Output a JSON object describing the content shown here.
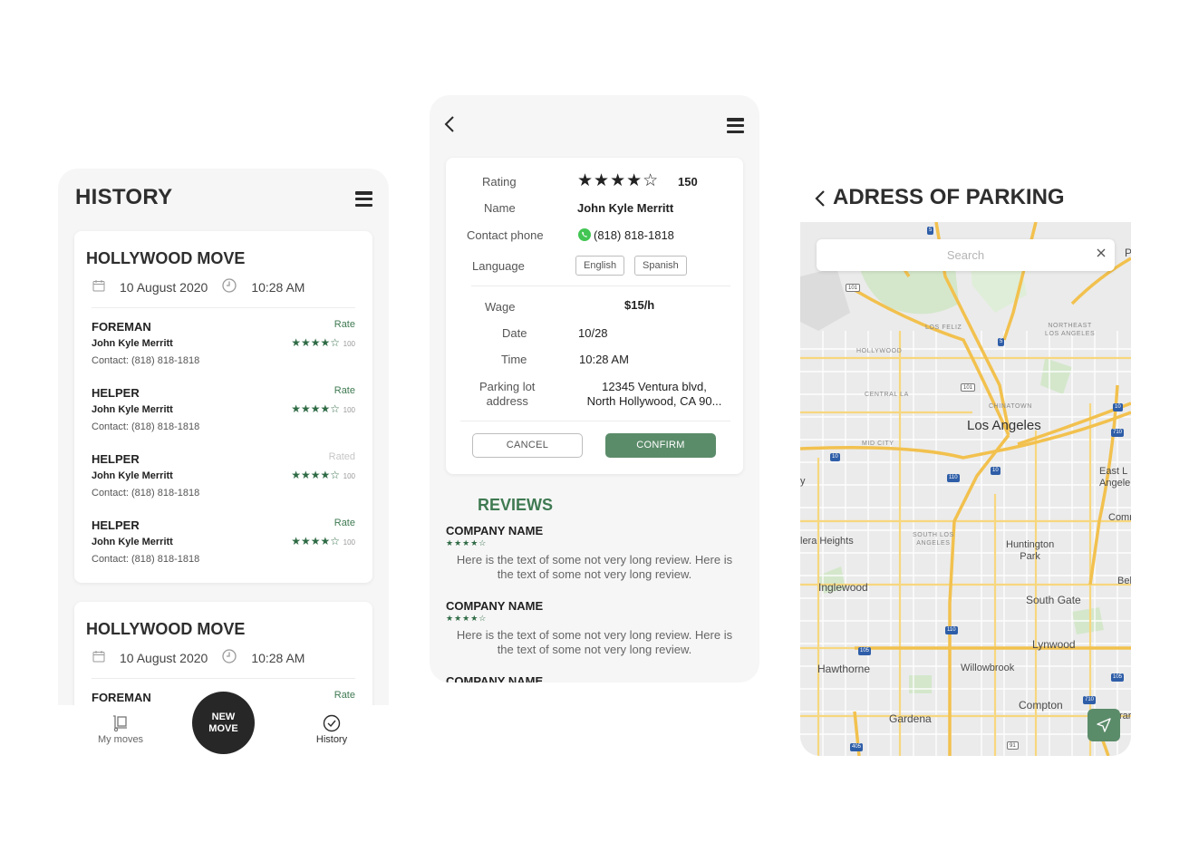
{
  "history": {
    "title": "HISTORY",
    "moves": [
      {
        "title": "HOLLYWOOD MOVE",
        "date": "10 August 2020",
        "time": "10:28 AM",
        "workers": [
          {
            "role": "FOREMAN",
            "name": "John Kyle Merritt",
            "contact": "Contact: (818) 818-1818",
            "action": "Rate",
            "stars": "★★★★☆",
            "count": "100"
          },
          {
            "role": "HELPER",
            "name": "John Kyle Merritt",
            "contact": "Contact: (818) 818-1818",
            "action": "Rate",
            "stars": "★★★★☆",
            "count": "100"
          },
          {
            "role": "HELPER",
            "name": "John Kyle Merritt",
            "contact": "Contact: (818) 818-1818",
            "action": "Rated",
            "stars": "★★★★☆",
            "count": "100"
          },
          {
            "role": "HELPER",
            "name": "John Kyle Merritt",
            "contact": "Contact: (818) 818-1818",
            "action": "Rate",
            "stars": "★★★★☆",
            "count": "100"
          }
        ]
      },
      {
        "title": "HOLLYWOOD MOVE",
        "date": "10 August 2020",
        "time": "10:28 AM",
        "workers": [
          {
            "role": "FOREMAN",
            "action": "Rate"
          }
        ]
      }
    ],
    "tabs": {
      "my_moves": "My moves",
      "new_move_line1": "NEW",
      "new_move_line2": "MOVE",
      "history": "History"
    }
  },
  "detail": {
    "labels": {
      "rating": "Rating",
      "name": "Name",
      "contact_phone": "Contact phone",
      "language": "Language",
      "wage": "Wage",
      "date": "Date",
      "time": "Time",
      "parking_line1": "Parking lot",
      "parking_line2": "address"
    },
    "values": {
      "stars": "★★★★☆",
      "rating_count": "150",
      "name": "John Kyle Merritt",
      "phone": "(818) 818-1818",
      "languages": [
        "English",
        "Spanish"
      ],
      "wage": "$15/h",
      "date": "10/28",
      "time": "10:28 AM",
      "address_line1": "12345 Ventura blvd,",
      "address_line2": "North Hollywood, CA 90..."
    },
    "buttons": {
      "cancel": "CANCEL",
      "confirm": "CONFIRM"
    },
    "reviews_title": "REVIEWS",
    "reviews": [
      {
        "company": "COMPANY NAME",
        "stars": "★★★★☆",
        "text_line1": "Here is the text of some not very long review. Here is",
        "text_line2": "the text of some not very long review."
      },
      {
        "company": "COMPANY NAME",
        "stars": "★★★★☆",
        "text_line1": "Here is the text of some not very long review. Here is",
        "text_line2": "the text of some not very long review."
      },
      {
        "company": "COMPANY NAME"
      }
    ]
  },
  "map_screen": {
    "title": "ADRESS OF PARKING",
    "search_placeholder": "Search",
    "labels": {
      "los_angeles": "Los Angeles",
      "los_feliz": "LOS FELIZ",
      "northeast_la_1": "NORTHEAST",
      "northeast_la_2": "LOS ANGELES",
      "hollywood": "HOLLYWOOD",
      "central_la": "CENTRAL LA",
      "chinatown": "CHINATOWN",
      "mid_city": "MID CITY",
      "east_la_1": "East L",
      "east_la_2": "Angele",
      "commerce": "Comm",
      "south_la_1": "SOUTH LOS",
      "south_la_2": "ANGELES",
      "huntington_1": "Huntington",
      "huntington_2": "Park",
      "heights": "lera Heights",
      "bell": "Bel",
      "inglewood": "Inglewood",
      "south_gate": "South Gate",
      "lynwood": "Lynwood",
      "hawthorne": "Hawthorne",
      "willowbrook": "Willowbrook",
      "compton": "Compton",
      "gardena": "Gardena",
      "r_edge": "P",
      "y_edge": "y",
      "rar_edge": "rar"
    },
    "shields": [
      "5",
      "101",
      "5",
      "101",
      "10",
      "710",
      "10",
      "110",
      "10",
      "110",
      "105",
      "105",
      "710",
      "405",
      "91"
    ]
  },
  "colors": {
    "accent": "#3f7a52",
    "button": "#5b8c6a",
    "dark": "#272727"
  }
}
